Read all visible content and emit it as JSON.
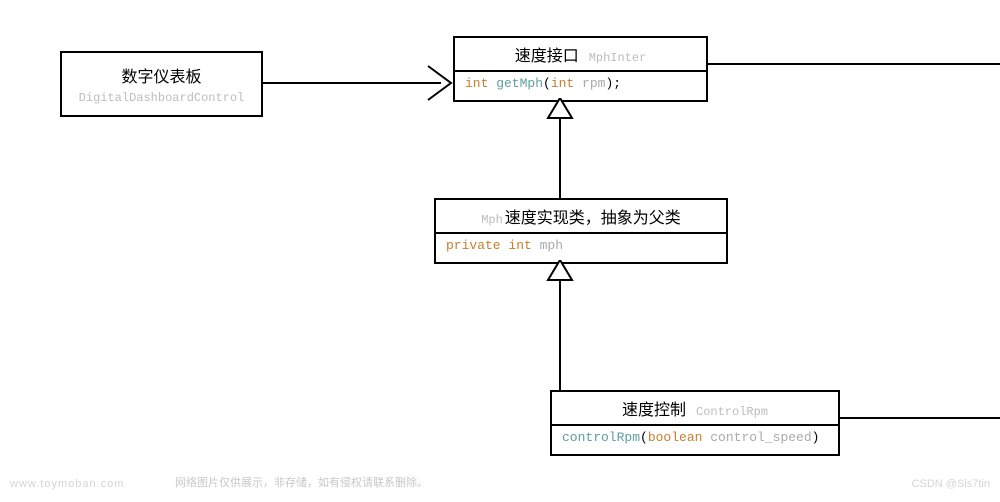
{
  "boxes": {
    "dashboard": {
      "title_cn": "数字仪表板",
      "title_en": "DigitalDashboardControl"
    },
    "interface": {
      "title_cn": "速度接口",
      "title_en": "MphInter",
      "method_kw1": "int",
      "method_fn": " getMph",
      "method_paren_open": "(",
      "method_kw2": "int",
      "method_param": " rpm",
      "method_close": ");"
    },
    "impl": {
      "prefix_en": "Mph",
      "title_cn": "速度实现类，抽象为父类",
      "field_kw": "private int",
      "field_name": " mph"
    },
    "control": {
      "title_cn": "速度控制",
      "title_en": "ControlRpm",
      "method_fn": "controlRpm",
      "method_paren_open": "(",
      "method_kw": "boolean",
      "method_param": " control_speed",
      "method_close": ")"
    }
  },
  "watermark_left": "www.toymoban.com",
  "footer_note": "网络图片仅供展示，非存储，如有侵权请联系删除。",
  "watermark_right": "CSDN @Sis7tin"
}
